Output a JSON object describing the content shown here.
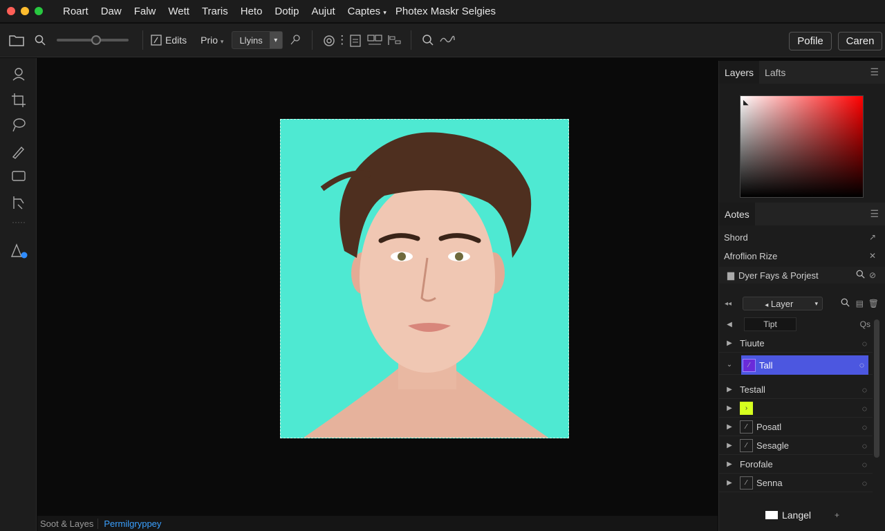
{
  "menubar": {
    "items": [
      "Roart",
      "Daw",
      "Falw",
      "Wett",
      "Traris",
      "Heto",
      "Dotip",
      "Aujut"
    ],
    "captes_label": "Captes",
    "app_title": "Photex Maskr Selgies"
  },
  "toolbar": {
    "edits_label": "Edits",
    "prio_label": "Prio",
    "lyins_value": "Llyins",
    "profile_label": "Pofile",
    "cancel_label": "Caren",
    "slider_value": 0.55
  },
  "status": {
    "left": "Soot & Layes",
    "right": "Permilgryppey"
  },
  "panel": {
    "tab_layers": "Layers",
    "tab_lafts": "Lafts",
    "tab_aotes": "Aotes",
    "row_shord": "Shord",
    "row_afrofion": "Afroflion Rize",
    "folder_label": "Dyer Fays & Porjest",
    "layer_dropdown": "Layer",
    "tipt_label": "Tipt",
    "qs_label": "Qs",
    "layers": [
      {
        "name": "Tiuute"
      },
      {
        "name": "Tall"
      },
      {
        "name": "Testall"
      },
      {
        "name": ""
      },
      {
        "name": "Posatl"
      },
      {
        "name": "Sesagle"
      },
      {
        "name": "Forofale"
      },
      {
        "name": "Senna"
      }
    ],
    "bottom_label": "Langel"
  },
  "colors": {
    "accent": "#4c57e0",
    "photo_bg": "#4ee9d2",
    "link": "#3aa0ff"
  }
}
